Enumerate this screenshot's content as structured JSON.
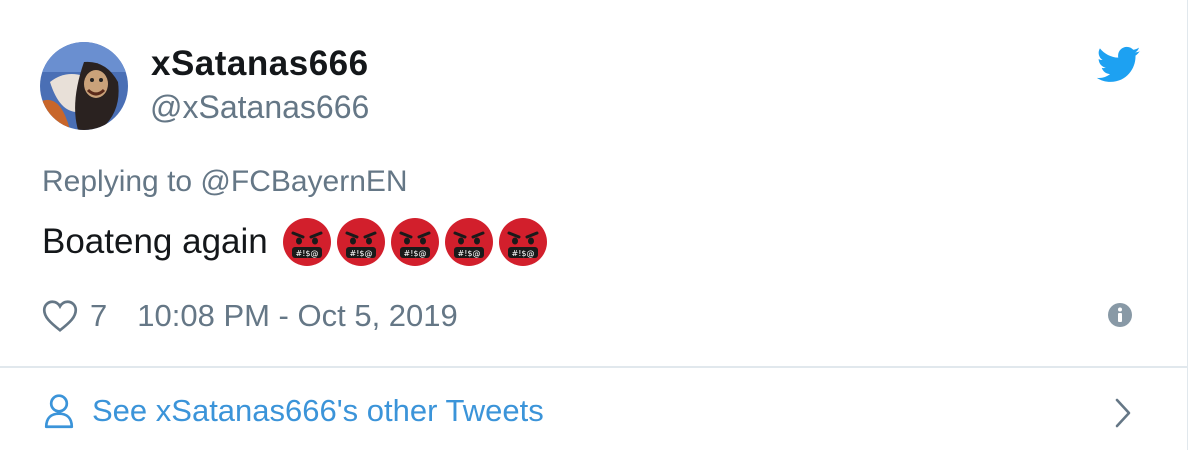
{
  "user": {
    "display_name": "xSatanas666",
    "handle": "@xSatanas666"
  },
  "tweet": {
    "reply_label": "Replying to @FCBayernEN",
    "text": "Boateng again",
    "emoji_icon": "face-with-symbols-on-mouth-icon",
    "emoji_count": 5,
    "like_count": "7",
    "timestamp": "10:08 PM - Oct 5, 2019"
  },
  "footer": {
    "other_tweets_label": "See xSatanas666's other Tweets"
  },
  "colors": {
    "name": "#14171a",
    "secondary": "#657786",
    "link": "#3b94d9",
    "twitter_blue": "#1da1f2",
    "emoji_red": "#d21f2c"
  }
}
